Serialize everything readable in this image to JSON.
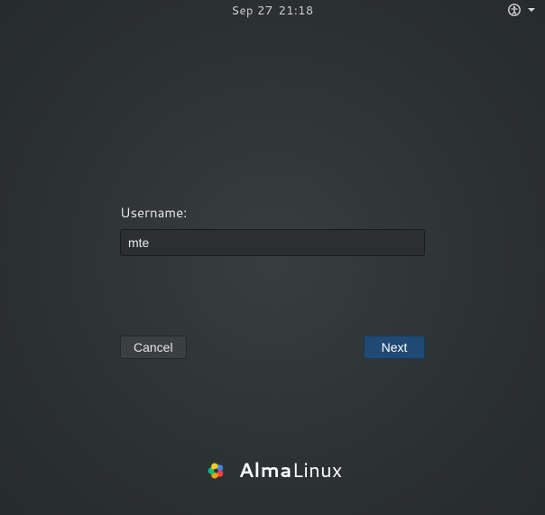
{
  "topbar": {
    "date": "Sep 27",
    "time": "21:18"
  },
  "login": {
    "username_label": "Username:",
    "username_value": "mte"
  },
  "buttons": {
    "cancel": "Cancel",
    "next": "Next"
  },
  "branding": {
    "name_bold": "Alma",
    "name_light": "Linux"
  },
  "colors": {
    "accent": "#1f4a73",
    "background": "#2e3436",
    "text": "#e6e6e6"
  }
}
